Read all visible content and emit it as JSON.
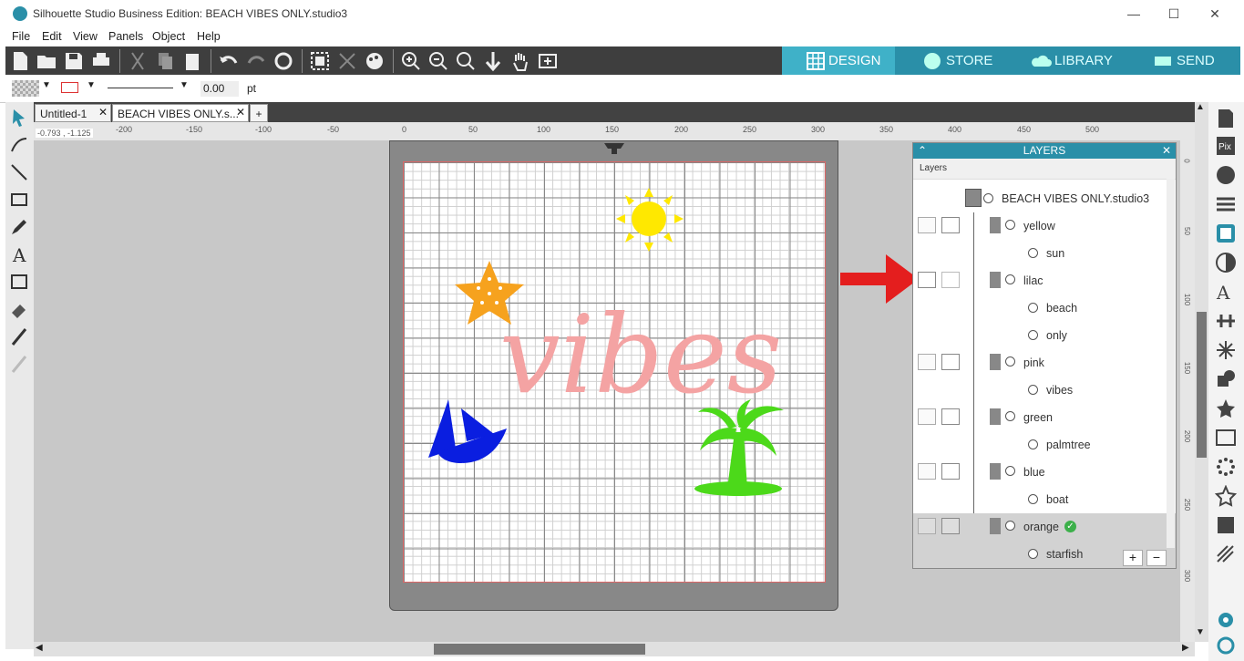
{
  "window": {
    "title": "Silhouette Studio Business Edition: BEACH VIBES ONLY.studio3"
  },
  "menu": [
    "File",
    "Edit",
    "View",
    "Panels",
    "Object",
    "Help"
  ],
  "nav": {
    "design": "DESIGN",
    "store": "STORE",
    "library": "LIBRARY",
    "send": "SEND"
  },
  "stylebar": {
    "line_width": "0.00",
    "unit": "pt"
  },
  "doc_tabs": [
    {
      "label": "Untitled-1"
    },
    {
      "label": "BEACH VIBES ONLY.s..."
    }
  ],
  "ruler": {
    "coords": "-0.793 , -1.125",
    "labels": [
      "-200",
      "-150",
      "-100",
      "-50",
      "0",
      "50",
      "100",
      "150",
      "200",
      "250",
      "300",
      "350",
      "400",
      "450",
      "500"
    ]
  },
  "vruler": [
    "0",
    "50",
    "100",
    "150",
    "200",
    "250",
    "300"
  ],
  "layers": {
    "title": "LAYERS",
    "subtitle": "Layers",
    "document": "BEACH VIBES ONLY.studio3",
    "groups": [
      {
        "name": "yellow",
        "child": "sun"
      },
      {
        "name": "lilac",
        "children": [
          "beach",
          "only"
        ]
      },
      {
        "name": "pink",
        "child": "vibes"
      },
      {
        "name": "green",
        "child": "palmtree"
      },
      {
        "name": "blue",
        "child": "boat"
      },
      {
        "name": "orange",
        "child": "starfish"
      }
    ]
  },
  "design": {
    "word": "vibes"
  },
  "colors": {
    "accent": "#2a8fa8",
    "active_tab": "#3fb1c8",
    "yellow": "#ffe800",
    "orange": "#f6a21e",
    "pink": "#f4a3a3",
    "blue": "#0a1ee0",
    "green": "#4cd91a",
    "arrow": "#e41e1e"
  }
}
